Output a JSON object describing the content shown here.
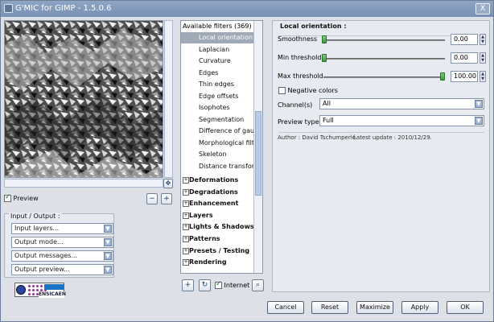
{
  "window": {
    "title": "G'MIC for GIMP - 1.5.0.6",
    "close_label": "X"
  },
  "preview": {
    "checkbox_label": "Preview"
  },
  "io": {
    "title": "Input / Output :",
    "combos": [
      "Input layers...",
      "Output mode...",
      "Output messages...",
      "Output preview..."
    ]
  },
  "filters": {
    "header": "Available filters (369) :",
    "items": [
      {
        "label": "Local orientation",
        "selected": true
      },
      {
        "label": "Laplacian"
      },
      {
        "label": "Curvature"
      },
      {
        "label": "Edges"
      },
      {
        "label": "Thin edges"
      },
      {
        "label": "Edge offsets"
      },
      {
        "label": "Isophotes"
      },
      {
        "label": "Segmentation"
      },
      {
        "label": "Difference of gaussi"
      },
      {
        "label": "Morphological filter"
      },
      {
        "label": "Skeleton"
      },
      {
        "label": "Distance transform"
      }
    ],
    "categories": [
      "Deformations",
      "Degradations",
      "Enhancement",
      "Layers",
      "Lights & Shadows",
      "Patterns",
      "Presets / Testing",
      "Rendering"
    ],
    "internet_label": "Internet"
  },
  "params": {
    "title": "Local orientation :",
    "smoothness": {
      "label": "Smoothness",
      "value": "0.00"
    },
    "min_threshold": {
      "label": "Min threshold",
      "value": "0.00"
    },
    "max_threshold": {
      "label": "Max threshold",
      "value": "100.00"
    },
    "negative_colors": "Negative colors",
    "channels": {
      "label": "Channel(s)",
      "value": "All"
    },
    "preview_type": {
      "label": "Preview type",
      "value": "Full"
    },
    "author": "Author : David Tschumperlé",
    "update": "Latest update : 2010/12/29."
  },
  "buttons": [
    "Cancel",
    "Reset",
    "Maximize",
    "Apply",
    "OK"
  ],
  "logo_text": "ENSICAEN"
}
